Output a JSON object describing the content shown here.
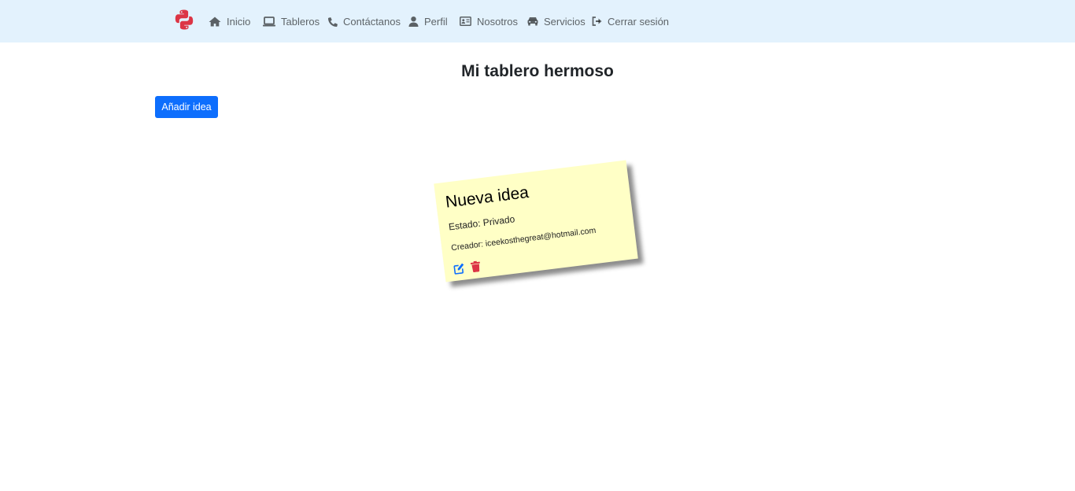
{
  "nav": {
    "items": [
      {
        "label": "Inicio",
        "icon": "home-icon"
      },
      {
        "label": "Tableros",
        "icon": "laptop-icon"
      },
      {
        "label": "Contáctanos",
        "icon": "phone-icon"
      },
      {
        "label": "Perfil",
        "icon": "user-icon"
      },
      {
        "label": "Nosotros",
        "icon": "id-card-icon"
      },
      {
        "label": "Servicios",
        "icon": "car-icon"
      },
      {
        "label": "Cerrar sesión",
        "icon": "sign-out-icon"
      }
    ],
    "brand_icon": "python-logo-icon",
    "background": "#e3f2fd"
  },
  "page": {
    "title": "Mi tablero hermoso",
    "add_button_label": "Añadir idea",
    "accent": "#0d6efd"
  },
  "notes": [
    {
      "title": "Nueva idea",
      "status": "Estado: Privado",
      "creator": "Creador: iceekosthegreat@hotmail.com",
      "color": "#ffffc6",
      "edit_icon": "edit-icon",
      "delete_icon": "trash-icon"
    }
  ]
}
